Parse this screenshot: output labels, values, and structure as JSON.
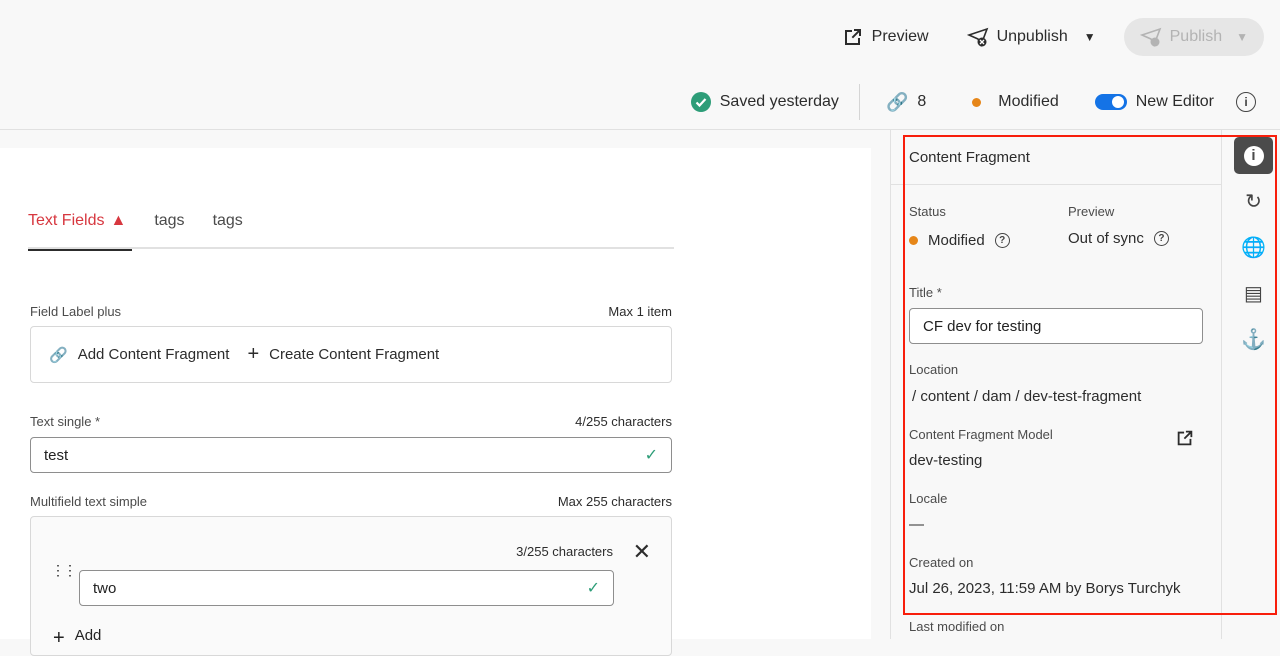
{
  "header": {
    "preview_label": "Preview",
    "unpublish_label": "Unpublish",
    "publish_label": "Publish",
    "saved_status": "Saved yesterday",
    "references_count": "8",
    "status": "Modified",
    "new_editor_label": "New Editor",
    "new_editor_on": true
  },
  "colors": {
    "accent": "#1473e6",
    "error": "#d7373f",
    "modified": "#e68619",
    "success": "#2d9d78",
    "highlight": "#f81e0b"
  },
  "tabs": [
    {
      "label": "Text Fields",
      "active": true,
      "warning": true
    },
    {
      "label": "tags"
    },
    {
      "label": "tags"
    }
  ],
  "fields": {
    "cf_ref": {
      "label": "Field Label plus",
      "meta": "Max 1 item",
      "add_label": "Add Content Fragment",
      "create_label": "Create Content Fragment"
    },
    "text_single": {
      "label": "Text single",
      "required": "*",
      "meta": "4/255 characters",
      "value": "test"
    },
    "multifield": {
      "label": "Multifield text simple",
      "meta": "Max 255 characters",
      "item_meta": "3/255 characters",
      "item_value": "two",
      "add_label": "Add"
    }
  },
  "panel": {
    "title": "Content Fragment",
    "status_label": "Status",
    "status_value": "Modified",
    "preview_label": "Preview",
    "preview_value": "Out of sync",
    "title_label": "Title",
    "title_required": "*",
    "title_value": "CF dev for testing",
    "location_label": "Location",
    "location_value": "/ content / dam / dev-test-fragment",
    "model_label": "Content Fragment Model",
    "model_value": "dev-testing",
    "locale_label": "Locale",
    "locale_value": "—",
    "created_label": "Created on",
    "created_value": "Jul 26, 2023, 11:59 AM by Borys Turchyk",
    "modified_label": "Last modified on"
  },
  "rail": [
    "info-icon",
    "history-icon",
    "globe-icon",
    "bed-icon",
    "anchor-icon"
  ]
}
